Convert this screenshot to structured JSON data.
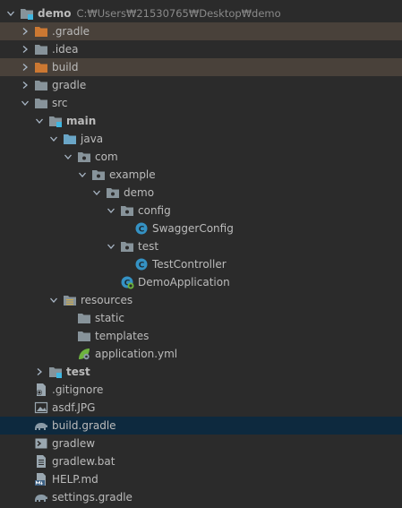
{
  "project": {
    "name": "demo",
    "path": "C:₩Users₩21530765₩Desktop₩demo"
  },
  "tree": {
    "gradle_dir": ".gradle",
    "idea_dir": ".idea",
    "build_dir": "build",
    "gradle_wrapper_dir": "gradle",
    "src": "src",
    "main": "main",
    "java": "java",
    "com": "com",
    "example": "example",
    "demo_pkg": "demo",
    "config": "config",
    "swagger_config": "SwaggerConfig",
    "test_pkg": "test",
    "test_controller": "TestController",
    "demo_application": "DemoApplication",
    "resources": "resources",
    "static": "static",
    "templates": "templates",
    "application_yml": "application.yml",
    "test_root": "test",
    "gitignore": ".gitignore",
    "asdf_jpg": "asdf.JPG",
    "build_gradle": "build.gradle",
    "gradlew": "gradlew",
    "gradlew_bat": "gradlew.bat",
    "help_md": "HELP.md",
    "settings_gradle": "settings.gradle"
  },
  "colors": {
    "background": "#2b2b2b",
    "excluded_row": "#49413a",
    "selected_row": "#0d293e",
    "folder": "#87939a",
    "excluded_folder": "#cc7832",
    "source_folder": "#6aa6c7",
    "class_icon": "#3592c4"
  }
}
